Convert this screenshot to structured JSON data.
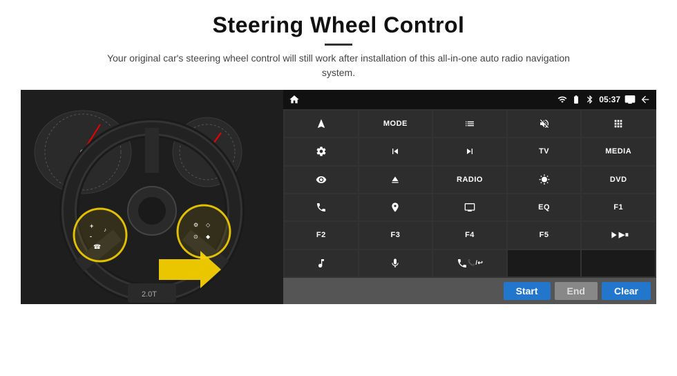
{
  "header": {
    "title": "Steering Wheel Control",
    "subtitle": "Your original car's steering wheel control will still work after installation of this all-in-one auto radio navigation system."
  },
  "status_bar": {
    "time": "05:37",
    "wifi_icon": "wifi",
    "battery_icon": "battery",
    "signal_icon": "signal",
    "home_icon": "home",
    "back_icon": "back",
    "apps_icon": "apps",
    "volume_icon": "volume"
  },
  "grid_buttons": [
    {
      "row": 1,
      "col": 1,
      "type": "icon",
      "label": "navigate",
      "icon": "arrow-up-right"
    },
    {
      "row": 1,
      "col": 2,
      "type": "text",
      "label": "MODE"
    },
    {
      "row": 1,
      "col": 3,
      "type": "icon",
      "label": "list"
    },
    {
      "row": 1,
      "col": 4,
      "type": "icon",
      "label": "mute"
    },
    {
      "row": 1,
      "col": 5,
      "type": "icon",
      "label": "apps-grid"
    },
    {
      "row": 2,
      "col": 1,
      "type": "icon",
      "label": "settings-circle"
    },
    {
      "row": 2,
      "col": 2,
      "type": "icon",
      "label": "prev"
    },
    {
      "row": 2,
      "col": 3,
      "type": "icon",
      "label": "next"
    },
    {
      "row": 2,
      "col": 4,
      "type": "text",
      "label": "TV"
    },
    {
      "row": 2,
      "col": 5,
      "type": "text",
      "label": "MEDIA"
    },
    {
      "row": 3,
      "col": 1,
      "type": "icon",
      "label": "360-cam"
    },
    {
      "row": 3,
      "col": 2,
      "type": "icon",
      "label": "eject"
    },
    {
      "row": 3,
      "col": 3,
      "type": "text",
      "label": "RADIO"
    },
    {
      "row": 3,
      "col": 4,
      "type": "icon",
      "label": "brightness"
    },
    {
      "row": 3,
      "col": 5,
      "type": "text",
      "label": "DVD"
    },
    {
      "row": 4,
      "col": 1,
      "type": "icon",
      "label": "phone"
    },
    {
      "row": 4,
      "col": 2,
      "type": "icon",
      "label": "navigation"
    },
    {
      "row": 4,
      "col": 3,
      "type": "icon",
      "label": "screen"
    },
    {
      "row": 4,
      "col": 4,
      "type": "text",
      "label": "EQ"
    },
    {
      "row": 4,
      "col": 5,
      "type": "text",
      "label": "F1"
    },
    {
      "row": 5,
      "col": 1,
      "type": "text",
      "label": "F2"
    },
    {
      "row": 5,
      "col": 2,
      "type": "text",
      "label": "F3"
    },
    {
      "row": 5,
      "col": 3,
      "type": "text",
      "label": "F4"
    },
    {
      "row": 5,
      "col": 4,
      "type": "text",
      "label": "F5"
    },
    {
      "row": 5,
      "col": 5,
      "type": "icon",
      "label": "play-pause"
    },
    {
      "row": 6,
      "col": 1,
      "type": "icon",
      "label": "music"
    },
    {
      "row": 6,
      "col": 2,
      "type": "icon",
      "label": "microphone"
    },
    {
      "row": 6,
      "col": 3,
      "type": "icon",
      "label": "phone-call",
      "colspan": 1
    }
  ],
  "bottom_bar": {
    "start_label": "Start",
    "end_label": "End",
    "clear_label": "Clear"
  }
}
